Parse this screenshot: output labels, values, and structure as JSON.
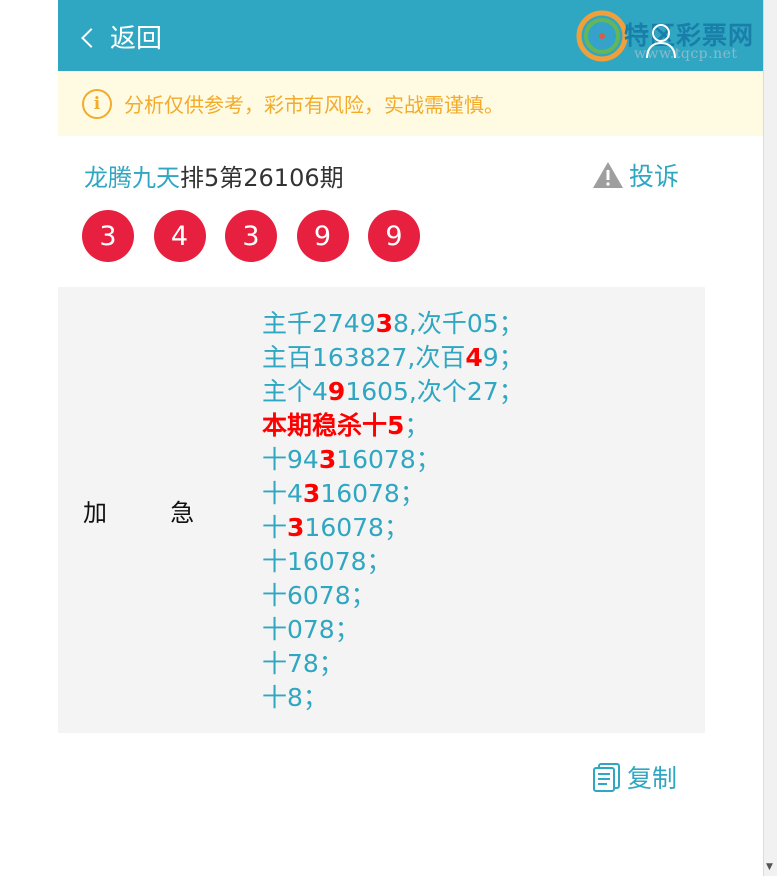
{
  "header": {
    "back_label": "返回",
    "bg_color": "#30a7c2"
  },
  "watermark": {
    "name": "特区彩票网",
    "url": "www.tqcp.net"
  },
  "notice": {
    "text": "分析仅供参考，彩市有风险，实战需谨慎。",
    "color": "#f2ab2b"
  },
  "title": {
    "expert": "龙腾九天",
    "issue": "排5第26106期"
  },
  "complain_label": "投诉",
  "balls": [
    "3",
    "4",
    "3",
    "9",
    "9"
  ],
  "content": {
    "tag_a": "加",
    "tag_b": "急",
    "lines": [
      {
        "parts": [
          {
            "t": "主千2749"
          },
          {
            "t": "3",
            "hl": true
          },
          {
            "t": "8,次千05；"
          }
        ]
      },
      {
        "parts": [
          {
            "t": "主百163827,次百"
          },
          {
            "t": "4",
            "hl": true
          },
          {
            "t": "9；"
          }
        ]
      },
      {
        "parts": [
          {
            "t": "主个4"
          },
          {
            "t": "9",
            "hl": true
          },
          {
            "t": "1605,次个27；"
          }
        ]
      },
      {
        "parts": [
          {
            "t": "本期稳杀十5",
            "bold": true
          },
          {
            "t": "；"
          }
        ],
        "kill": true
      },
      {
        "parts": [
          {
            "t": "十94"
          },
          {
            "t": "3",
            "hl": true
          },
          {
            "t": "16078；"
          }
        ]
      },
      {
        "parts": [
          {
            "t": "十4"
          },
          {
            "t": "3",
            "hl": true
          },
          {
            "t": "16078；"
          }
        ]
      },
      {
        "parts": [
          {
            "t": "十"
          },
          {
            "t": "3",
            "hl": true
          },
          {
            "t": "16078；"
          }
        ]
      },
      {
        "parts": [
          {
            "t": "十16078；"
          }
        ]
      },
      {
        "parts": [
          {
            "t": "十6078；"
          }
        ]
      },
      {
        "parts": [
          {
            "t": "十078；"
          }
        ]
      },
      {
        "parts": [
          {
            "t": "十78；"
          }
        ]
      },
      {
        "parts": [
          {
            "t": "十8；"
          }
        ]
      }
    ]
  },
  "copy_label": "复制",
  "icons": {
    "back": "chevron-left-icon",
    "user": "user-icon",
    "info": "info-icon",
    "warning": "warning-icon",
    "copy": "copy-document-icon"
  }
}
